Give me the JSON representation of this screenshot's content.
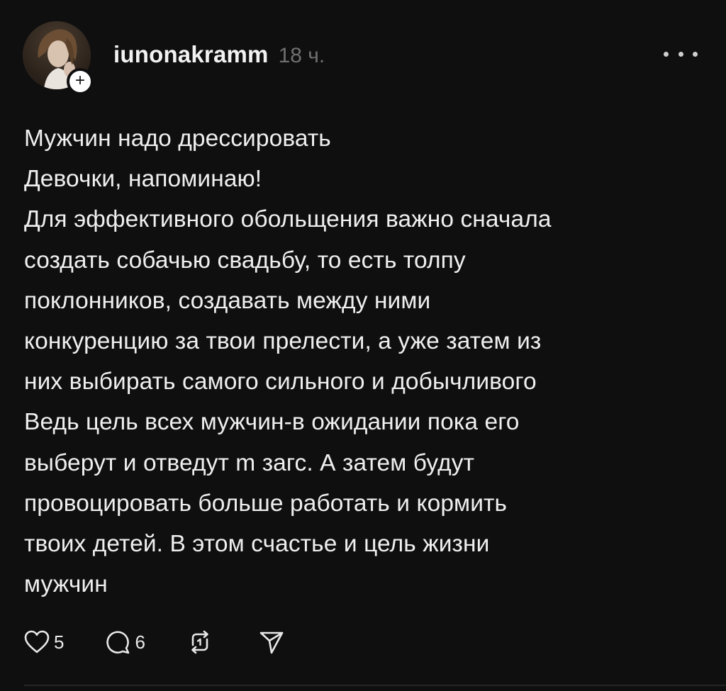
{
  "post": {
    "author": "iunonakramm",
    "time": "18 ч.",
    "follow_symbol": "+",
    "lines": [
      "Мужчин надо дрессировать",
      "Девочки, напоминаю!",
      "Для эффективного обольщения важно сначала",
      "создать собачью свадьбу, то есть толпу",
      "поклонников, создавать между ними",
      "конкуренцию за твои прелести, а уже затем из",
      "них выбирать самого сильного и добычливого",
      "Ведь цель всех мужчин-в ожидании пока его",
      "выберут и отведут m загс. А затем будут",
      "провоцировать больше работать и кормить",
      "твоих детей. В этом счастье и цель жизни",
      "мужчин"
    ]
  },
  "actions": {
    "like_count": "5",
    "reply_count": "6",
    "icons": [
      "heart-icon",
      "comment-icon",
      "repost-icon",
      "share-icon",
      "more-icon"
    ]
  },
  "colors": {
    "background": "#0f0f0f",
    "text": "#efefef",
    "muted": "#6f6f6f"
  }
}
